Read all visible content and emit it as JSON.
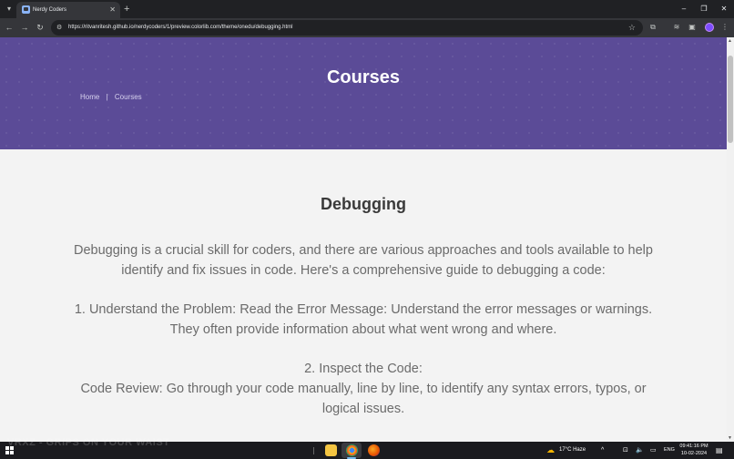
{
  "browser": {
    "tab_search_icon": "▾",
    "tab_title": "Nerdy Coders",
    "tab_close": "✕",
    "new_tab": "+",
    "window": {
      "minimize": "–",
      "restore": "❐",
      "close": "✕"
    },
    "nav": {
      "back": "←",
      "forward": "→",
      "reload": "↻"
    },
    "site_info_icon": "⚙",
    "url": "https://ritvanritesh.github.io/nerdycoders/1/preview.colorlib.com/theme/onedu/debugging.html",
    "bookmark_icon": "☆",
    "toolbar_icons": {
      "extensions": "⧉",
      "media": "≋",
      "sidepanel": "▣",
      "menu": "⋮"
    }
  },
  "hero": {
    "title": "Courses",
    "breadcrumb": {
      "home": "Home",
      "separator": "|",
      "current": "Courses"
    },
    "background_color": "#5b4b97"
  },
  "content": {
    "title": "Debugging",
    "p1": "Debugging is a crucial skill for coders, and there are various approaches and tools available to help identify and fix issues in code. Here's a comprehensive guide to debugging a code:",
    "p2": "1. Understand the Problem: Read the Error Message: Understand the error messages or warnings. They often provide information about what went wrong and where.",
    "p3": "2. Inspect the Code:",
    "p4": "Code Review: Go through your code manually, line by line, to identify any syntax errors, typos, or logical issues."
  },
  "taskbar": {
    "media_text": "VRXZ - GRIPS ON YOUR WAIST",
    "weather": "17°C  Haze",
    "weather_icon": "☁",
    "tray": {
      "chevron": "^",
      "network": "⊡",
      "volume": "🔈",
      "battery": "▭"
    },
    "language": "ENG",
    "time": "09:41:16 PM",
    "date": "10-02-2024",
    "notifications_icon": "▤"
  }
}
